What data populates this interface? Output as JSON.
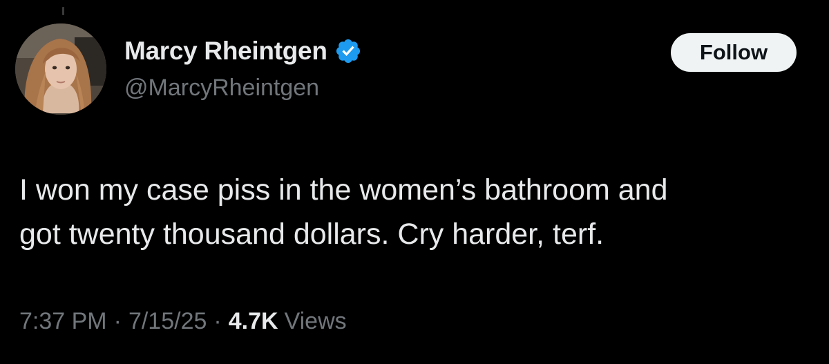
{
  "author": {
    "display_name": "Marcy Rheintgen",
    "handle": "@MarcyRheintgen",
    "verified": true,
    "avatar_icon": "profile-photo"
  },
  "follow_button": {
    "label": "Follow"
  },
  "tweet": {
    "text_lines": [
      "I won my case piss in the women’s bathroom and",
      "got twenty thousand dollars. Cry harder, terf."
    ]
  },
  "meta": {
    "time": "7:37 PM",
    "date": "7/15/25",
    "separator": "·",
    "views_count": "4.7K",
    "views_label": "Views"
  },
  "colors": {
    "background": "#000000",
    "primary_text": "#e7e9ea",
    "secondary_text": "#71767b",
    "verified_blue": "#1d9bf0",
    "button_bg": "#eff3f4",
    "button_text": "#0f1419"
  }
}
